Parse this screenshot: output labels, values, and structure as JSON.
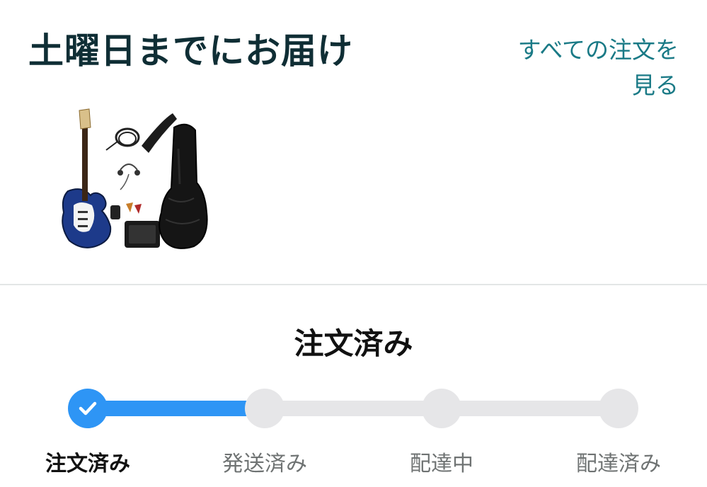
{
  "header": {
    "title": "土曜日までにお届け",
    "see_all_line1": "すべての注文を",
    "see_all_line2": "見る"
  },
  "product": {
    "image_name": "electric-guitar-starter-set"
  },
  "status": {
    "title": "注文済み",
    "progress": 0.33,
    "steps": [
      {
        "label": "注文済み",
        "state": "done"
      },
      {
        "label": "発送済み",
        "state": "pending"
      },
      {
        "label": "配達中",
        "state": "pending"
      },
      {
        "label": "配達済み",
        "state": "pending"
      }
    ]
  },
  "colors": {
    "accent": "#2e95f5",
    "link": "#1a7a86",
    "title": "#0f2e35",
    "track": "#e6e6e8"
  }
}
